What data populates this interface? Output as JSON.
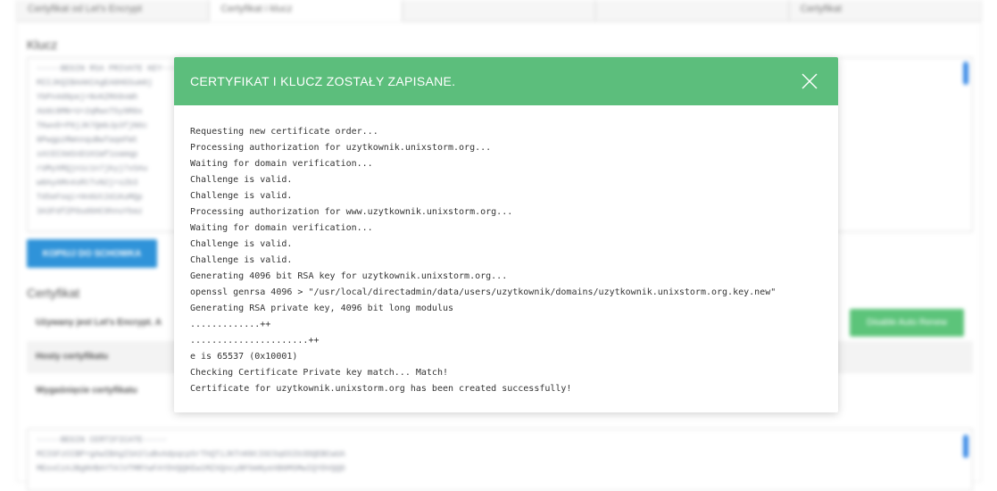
{
  "background": {
    "tabs": [
      "Certyfikat od Let's Encrypt",
      "Certyfikat i klucz",
      "",
      "",
      "Certyfikat"
    ],
    "key_section_title": "Klucz",
    "key_text": [
      "-----BEGIN RSA PRIVATE KEY-----",
      "MIIJKQIBAAKCAgEA0HGSum0j",
      "YbPn4d8pej+NvKZMX0vWh",
      "AUdc8MN+U+2qRwxT5y9R0x",
      "TKwvD+P8jJK7QmbJp3fjN6c",
      "8PwgpzRWnnquBwTaqeFWt",
      "xAtECXmSnD1H1Wf1oamqp",
      "rUMyXRQjn1c1n7jkyj7xSAu",
      "w0AyAMn4sRtTvN2j+s2b3",
      "Td5eFoqi+Hn6Ut2diKuMQp",
      "3A3FdfZPOud6HC9hnuYbaz"
    ],
    "copy_button": "KOPIUJ DO SCHOWKA",
    "cert_section_title": "Certyfikat",
    "cert_rows": [
      "Używany jest Let's Encrypt. A",
      "Hosty certyfikatu",
      "Wygaśnięcie certyfikatu"
    ],
    "renew_button": "Disable Auto Renew",
    "cert_text": [
      "-----BEGIN CERTIFICATE-----",
      "MIIGFzCCBP+gAwIBAgISA3luBvAdpqcp5rThQTiJKTnKNtIGCSqGSIb3DQEBCwUA",
      "MEoxCzAJBgNVBAYTAlVTMRYwFAYDVQQKEw1MZXQncyBFbmNyeXB0MSMwIQYDVQQD"
    ]
  },
  "modal": {
    "title": "CERTYFIKAT I KLUCZ ZOSTAŁY ZAPISANE.",
    "log_lines": [
      "Requesting new certificate order...",
      "Processing authorization for uzytkownik.unixstorm.org...",
      "Waiting for domain verification...",
      "Challenge is valid.",
      "Challenge is valid.",
      "Processing authorization for www.uzytkownik.unixstorm.org...",
      "Waiting for domain verification...",
      "Challenge is valid.",
      "Challenge is valid.",
      "Generating 4096 bit RSA key for uzytkownik.unixstorm.org...",
      "openssl genrsa 4096 > \"/usr/local/directadmin/data/users/uzytkownik/domains/uzytkownik.unixstorm.org.key.new\"",
      "Generating RSA private key, 4096 bit long modulus",
      ".............++",
      "......................++",
      "e is 65537 (0x10001)",
      "Checking Certificate Private key match... Match!",
      "Certificate for uzytkownik.unixstorm.org has been created successfully!"
    ]
  },
  "colors": {
    "modal_header": "#5cbe7c",
    "primary_button": "#2f93d9",
    "success_button": "#5cc47a",
    "scrollbar": "#3b8be6"
  }
}
